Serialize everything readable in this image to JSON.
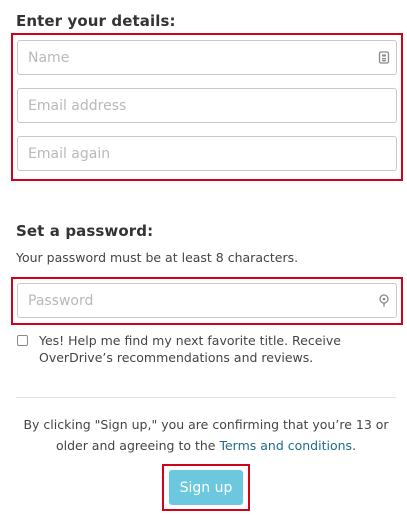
{
  "details": {
    "heading": "Enter your details:",
    "name_placeholder": "Name",
    "email_placeholder": "Email address",
    "email_again_placeholder": "Email again",
    "name_icon": "contact-card-icon"
  },
  "password": {
    "heading": "Set a password:",
    "hint": "Your password must be at least 8 characters.",
    "placeholder": "Password",
    "icon": "password-key-icon"
  },
  "opt_in": {
    "checked": false,
    "label": "Yes! Help me find my next favorite title. Receive OverDrive’s recommendations and reviews."
  },
  "legal": {
    "prefix": "By clicking \"Sign up,\" you are confirming that you’re 13 or older and agreeing to the",
    "link_text": "Terms and conditions",
    "suffix": "."
  },
  "signup": {
    "label": "Sign up"
  },
  "colors": {
    "highlight_border": "#d0021b",
    "button_bg": "#6bc8df",
    "link": "#1f6c8c"
  }
}
